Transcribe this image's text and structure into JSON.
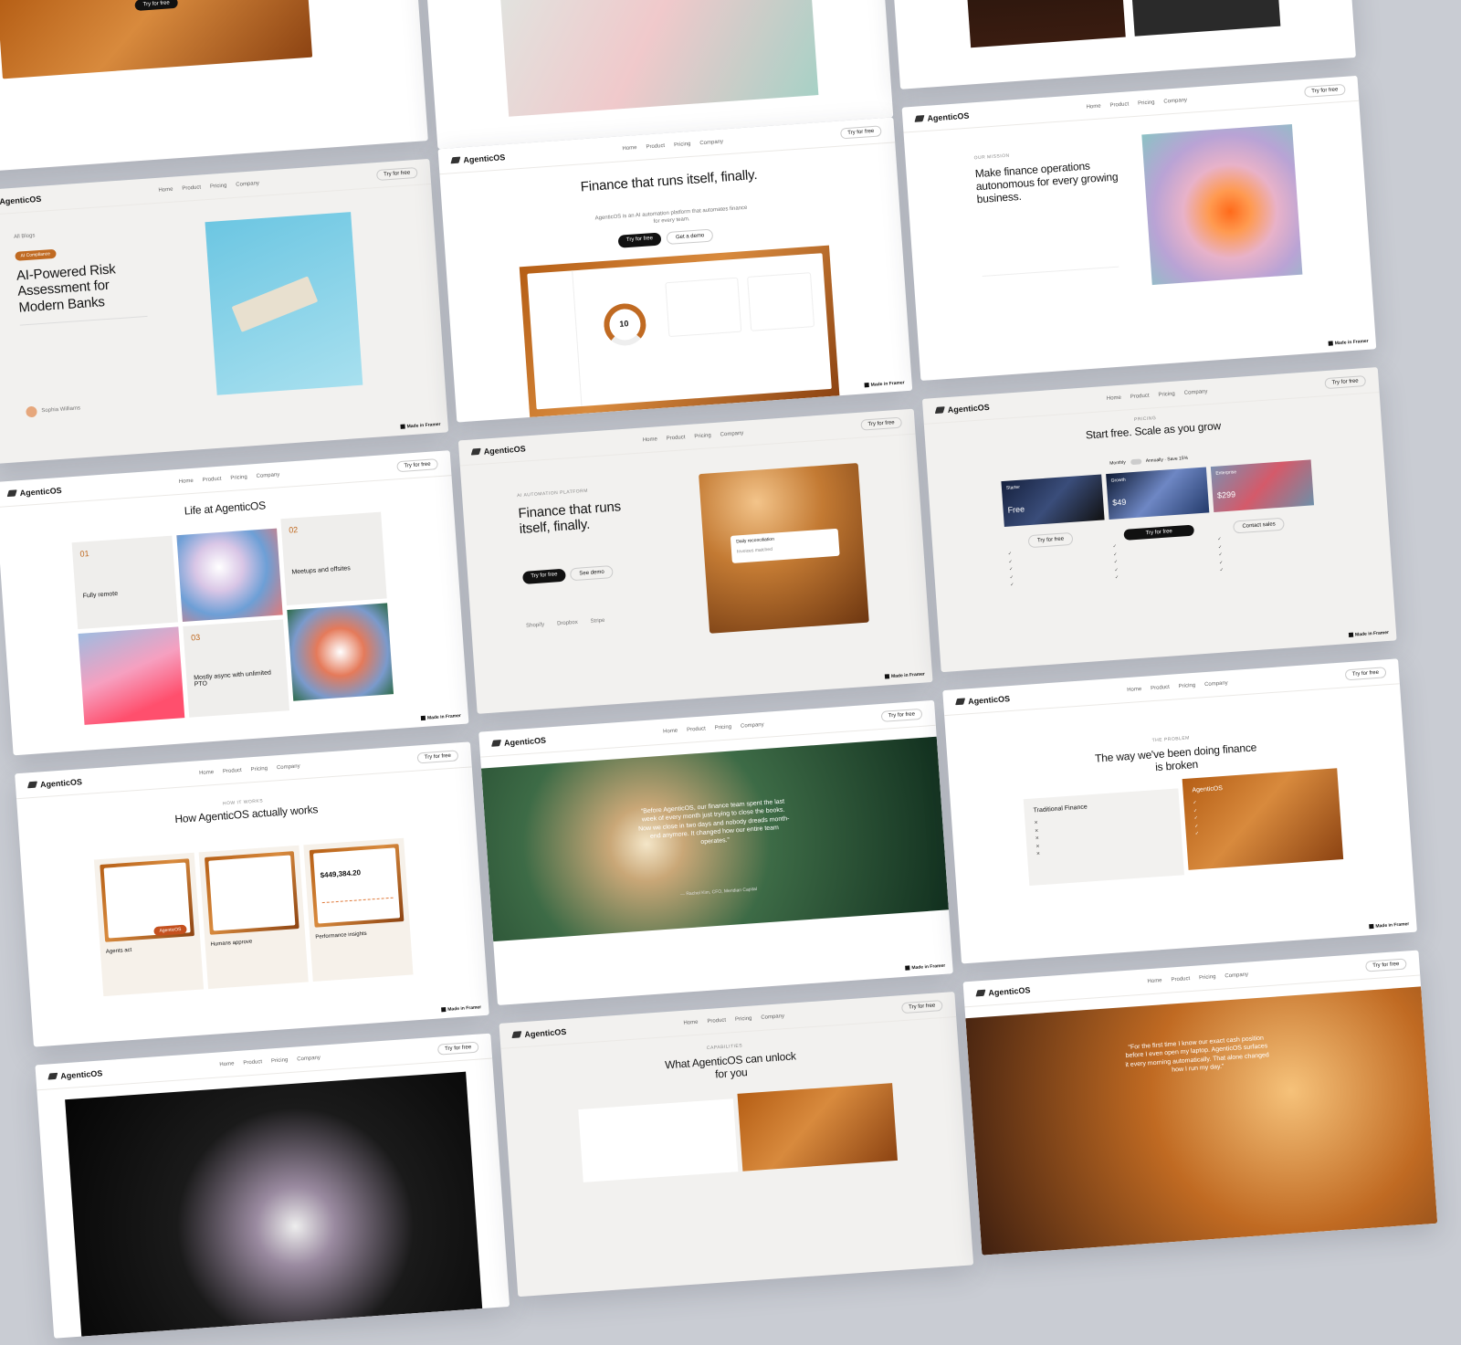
{
  "brand": "AgenticOS",
  "nav": {
    "items": [
      "Home",
      "Product",
      "Pricing",
      "Company"
    ],
    "cta": "Try for free"
  },
  "made_in": "Made in Framer",
  "cards": {
    "risk": {
      "back": "All Blogs",
      "tag": "AI Compliance",
      "title": "AI-Powered Risk Assessment for Modern Banks",
      "author": "Sophia Williams"
    },
    "hero": {
      "title": "Finance that runs itself, finally.",
      "subtitle": "AgenticOS is an AI automation platform that automates finance for every team.",
      "primary": "Try for free",
      "secondary": "Get a demo",
      "score": "10"
    },
    "mission": {
      "eyebrow": "Our mission",
      "title": "Make finance operations autonomous for every growing business."
    },
    "life": {
      "eyebrow": "Life at AgenticOS",
      "title": "Life at AgenticOS",
      "n1": "01",
      "t1": "Fully remote",
      "n2": "02",
      "t2": "Meetups and offsites",
      "n3": "03",
      "t3": "Mostly async with unlimited PTO"
    },
    "split": {
      "eyebrow": "AI automation platform",
      "title": "Finance that runs itself, finally.",
      "primary": "Try for free",
      "secondary": "See demo",
      "logos": [
        "Shopify",
        "Dropbox",
        "Stripe"
      ],
      "chip1": "Daily reconciliation",
      "chip2": "Invoices matched"
    },
    "pricing": {
      "eyebrow": "Pricing",
      "title": "Start free. Scale as you grow",
      "toggle": "Monthly",
      "toggle_alt": "Annually · Save 15%",
      "plans": [
        {
          "name": "Starter",
          "price": "Free",
          "cta": "Try for free"
        },
        {
          "name": "Growth",
          "price": "$49",
          "cta": "Try for free"
        },
        {
          "name": "Enterprise",
          "price": "$299",
          "cta": "Contact sales"
        }
      ]
    },
    "how": {
      "eyebrow": "How it works",
      "title": "How AgenticOS actually works",
      "f1": "Agents act",
      "f2": "Humans approve",
      "f3": "Performance insights",
      "amount": "$449,384.20",
      "pill": "AgenticOS"
    },
    "quote": {
      "text": "“Before AgenticOS, our finance team spent the last week of every month just trying to close the books. Now we close in two days and nobody dreads month-end anymore. It changed how our entire team operates.”",
      "author": "— Rachel Kim, CFO, Meridian Capital"
    },
    "broken": {
      "eyebrow": "The problem",
      "title": "The way we've been doing finance is broken",
      "left": "Traditional Finance",
      "right": "AgenticOS"
    },
    "unlock": {
      "eyebrow": "Capabilities",
      "title": "What AgenticOS can unlock for you"
    },
    "cashquote": {
      "text": "“For the first time I know our exact cash position before I even open my laptop. AgenticOS surfaces it every morning automatically. That alone changed how I run my day.”"
    }
  },
  "colors": {
    "accent": "#c06a22",
    "dark": "#111111"
  }
}
